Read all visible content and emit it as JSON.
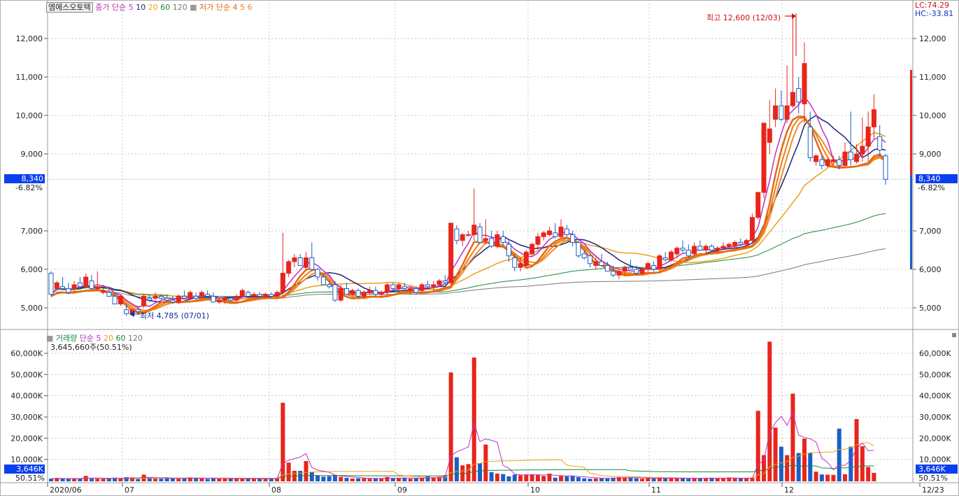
{
  "stock_name": "엠에스오토텍",
  "legend_price": {
    "ma_title": "종가 단순",
    "ma_periods": [
      "5",
      "10",
      "20",
      "60",
      "120"
    ],
    "env_title": "저가 단순",
    "env_periods": [
      "4",
      "5",
      "6"
    ]
  },
  "legend_volume": {
    "title": "거래량",
    "ma_title": "단순",
    "ma_periods": [
      "5",
      "20",
      "60",
      "120"
    ],
    "current": "3,645,660주(50.51%)"
  },
  "stats": {
    "lc": "LC:74.29",
    "hc": "HC:-33.81"
  },
  "annotations": {
    "high": "최고 12,600 (12/03)",
    "low": "최저 4,785 (07/01)"
  },
  "price_tag": {
    "value": "8,340",
    "change": "-6.82%"
  },
  "volume_tag": {
    "value": "3,646K",
    "pct": "50.51%"
  },
  "price_axis_labels": [
    "12,000",
    "11,000",
    "10,000",
    "9,000",
    "7,000",
    "6,000",
    "5,000"
  ],
  "volume_axis_labels": [
    "60,000K",
    "50,000K",
    "40,000K",
    "30,000K",
    "20,000K",
    "10,000K"
  ],
  "date_labels": [
    "2020/06",
    "07",
    "08",
    "09",
    "10",
    "11",
    "12",
    "12/23"
  ],
  "colors": {
    "up": "#e8251c",
    "down": "#1a5fc8",
    "ma5": "#c030c0",
    "ma10": "#1a237e",
    "ma20": "#e8a317",
    "ma60": "#1a8a3a",
    "ma120": "#7a7a7a",
    "env4": "#e36a12",
    "env5": "#ef7a1a",
    "env6": "#f08c2a"
  },
  "chart_data": {
    "type": "candlestick",
    "price_range": [
      4500,
      12900
    ],
    "volume_range_k": [
      0,
      68000
    ],
    "months": [
      "2020/06",
      "07",
      "08",
      "09",
      "10",
      "11",
      "12",
      "12/23"
    ],
    "ohlc_estimated": [
      [
        5900,
        5950,
        5300,
        5350
      ],
      [
        5500,
        5700,
        5450,
        5650
      ],
      [
        5550,
        5800,
        5450,
        5500
      ],
      [
        5500,
        5650,
        5350,
        5400
      ],
      [
        5500,
        5700,
        5400,
        5600
      ],
      [
        5650,
        5800,
        5500,
        5550
      ],
      [
        5550,
        5900,
        5500,
        5800
      ],
      [
        5700,
        5850,
        5450,
        5500
      ],
      [
        5500,
        5950,
        5450,
        5550
      ],
      [
        5400,
        5600,
        5350,
        5450
      ],
      [
        5400,
        5550,
        5300,
        5300
      ],
      [
        5300,
        5400,
        5100,
        5100
      ],
      [
        5100,
        5350,
        5050,
        5300
      ],
      [
        4950,
        5100,
        4785,
        4850
      ],
      [
        4850,
        5000,
        4800,
        4950
      ],
      [
        4950,
        5050,
        4850,
        4900
      ],
      [
        5050,
        5350,
        5000,
        5300
      ],
      [
        5250,
        5350,
        5150,
        5200
      ],
      [
        5250,
        5400,
        5200,
        5300
      ],
      [
        5300,
        5350,
        5200,
        5250
      ],
      [
        5250,
        5350,
        5150,
        5200
      ],
      [
        5200,
        5300,
        5100,
        5150
      ],
      [
        5150,
        5350,
        5100,
        5300
      ],
      [
        5300,
        5450,
        5250,
        5250
      ],
      [
        5250,
        5450,
        5200,
        5400
      ],
      [
        5300,
        5400,
        5200,
        5250
      ],
      [
        5300,
        5450,
        5250,
        5400
      ],
      [
        5350,
        5450,
        5250,
        5300
      ],
      [
        5300,
        5400,
        5150,
        5150
      ],
      [
        5150,
        5250,
        5100,
        5200
      ],
      [
        5200,
        5300,
        5100,
        5250
      ],
      [
        5250,
        5300,
        5150,
        5200
      ],
      [
        5200,
        5350,
        5150,
        5300
      ],
      [
        5300,
        5500,
        5250,
        5450
      ],
      [
        5400,
        5450,
        5300,
        5300
      ],
      [
        5300,
        5400,
        5250,
        5350
      ],
      [
        5350,
        5400,
        5250,
        5300
      ],
      [
        5300,
        5400,
        5250,
        5350
      ],
      [
        5350,
        5400,
        5250,
        5300
      ],
      [
        5300,
        5450,
        5250,
        5400
      ],
      [
        5400,
        6950,
        5350,
        5900
      ],
      [
        5900,
        6250,
        5800,
        6200
      ],
      [
        6200,
        6400,
        6050,
        6300
      ],
      [
        6300,
        6400,
        6100,
        6100
      ],
      [
        6050,
        6450,
        6000,
        6300
      ],
      [
        6300,
        6700,
        5950,
        6000
      ],
      [
        6000,
        6050,
        5700,
        5800
      ],
      [
        5800,
        5900,
        5600,
        5600
      ],
      [
        5600,
        5700,
        5500,
        5550
      ],
      [
        5600,
        5700,
        5150,
        5200
      ],
      [
        5200,
        5600,
        5150,
        5500
      ],
      [
        5500,
        5650,
        5350,
        5350
      ],
      [
        5350,
        5500,
        5300,
        5450
      ],
      [
        5450,
        5500,
        5250,
        5300
      ],
      [
        5300,
        5450,
        5250,
        5400
      ],
      [
        5400,
        5550,
        5350,
        5450
      ],
      [
        5450,
        5550,
        5300,
        5350
      ],
      [
        5350,
        5450,
        5250,
        5400
      ],
      [
        5400,
        5650,
        5350,
        5600
      ],
      [
        5600,
        5650,
        5450,
        5500
      ],
      [
        5500,
        5650,
        5450,
        5600
      ],
      [
        5550,
        5650,
        5450,
        5500
      ],
      [
        5450,
        5550,
        5350,
        5500
      ],
      [
        5500,
        5550,
        5350,
        5400
      ],
      [
        5450,
        5650,
        5400,
        5600
      ],
      [
        5600,
        5700,
        5500,
        5550
      ],
      [
        5550,
        5700,
        5450,
        5600
      ],
      [
        5600,
        5750,
        5550,
        5700
      ],
      [
        5700,
        5850,
        5600,
        5650
      ],
      [
        5650,
        7200,
        5600,
        7200
      ],
      [
        7050,
        7150,
        6650,
        6750
      ],
      [
        6750,
        6950,
        6600,
        6900
      ],
      [
        6900,
        7000,
        6850,
        6900
      ],
      [
        6900,
        8100,
        6750,
        7150
      ],
      [
        7100,
        7200,
        6650,
        6700
      ],
      [
        6750,
        7300,
        6650,
        6800
      ],
      [
        6800,
        7000,
        6550,
        6600
      ],
      [
        6600,
        7000,
        6550,
        6900
      ],
      [
        6850,
        7000,
        6600,
        6700
      ],
      [
        6650,
        6750,
        6200,
        6350
      ],
      [
        6300,
        6400,
        5950,
        6050
      ],
      [
        6050,
        6300,
        5950,
        6150
      ],
      [
        6100,
        6500,
        6050,
        6450
      ],
      [
        6400,
        6700,
        6350,
        6650
      ],
      [
        6650,
        6950,
        6500,
        6850
      ],
      [
        6850,
        7000,
        6750,
        6950
      ],
      [
        6900,
        7100,
        6850,
        7000
      ],
      [
        6950,
        7200,
        6800,
        6850
      ],
      [
        6850,
        7300,
        6800,
        7100
      ],
      [
        7050,
        7150,
        6850,
        6900
      ],
      [
        6900,
        7000,
        6600,
        6700
      ],
      [
        6700,
        6750,
        6300,
        6350
      ],
      [
        6400,
        6500,
        6250,
        6300
      ],
      [
        6350,
        6400,
        6050,
        6150
      ],
      [
        6100,
        6300,
        6000,
        6200
      ],
      [
        6200,
        6400,
        6100,
        6100
      ],
      [
        6100,
        6200,
        5950,
        5950
      ],
      [
        5950,
        6100,
        5800,
        5850
      ],
      [
        5850,
        6000,
        5750,
        5950
      ],
      [
        5950,
        6100,
        5850,
        6050
      ],
      [
        6050,
        6250,
        6000,
        6000
      ],
      [
        6000,
        6100,
        5850,
        5900
      ],
      [
        5900,
        6050,
        5850,
        6000
      ],
      [
        6000,
        6200,
        5950,
        6150
      ],
      [
        6100,
        6200,
        5950,
        6000
      ],
      [
        6000,
        6400,
        5950,
        6350
      ],
      [
        6300,
        6450,
        6200,
        6250
      ],
      [
        6250,
        6500,
        6200,
        6450
      ],
      [
        6400,
        6600,
        6300,
        6550
      ],
      [
        6550,
        6750,
        6450,
        6500
      ],
      [
        6500,
        6650,
        6300,
        6350
      ],
      [
        6400,
        6700,
        6350,
        6600
      ],
      [
        6600,
        6750,
        6500,
        6500
      ],
      [
        6500,
        6650,
        6400,
        6600
      ],
      [
        6600,
        6650,
        6450,
        6500
      ],
      [
        6500,
        6600,
        6450,
        6550
      ],
      [
        6550,
        6700,
        6500,
        6600
      ],
      [
        6600,
        6700,
        6550,
        6650
      ],
      [
        6600,
        6750,
        6550,
        6700
      ],
      [
        6700,
        6800,
        6600,
        6650
      ],
      [
        6650,
        6800,
        6600,
        6750
      ],
      [
        6750,
        7450,
        6700,
        7350
      ],
      [
        7350,
        7950,
        7300,
        8000
      ],
      [
        8000,
        9800,
        7850,
        9800
      ],
      [
        9300,
        10400,
        9000,
        9650
      ],
      [
        9900,
        10700,
        9700,
        10250
      ],
      [
        10250,
        10650,
        9850,
        9900
      ],
      [
        9900,
        11300,
        9800,
        10250
      ],
      [
        10250,
        12600,
        10200,
        10600
      ],
      [
        10700,
        11000,
        10050,
        10350
      ],
      [
        10300,
        11900,
        9800,
        11350
      ],
      [
        9700,
        10100,
        8800,
        8900
      ],
      [
        8800,
        9000,
        8700,
        8950
      ],
      [
        8850,
        8950,
        8600,
        8700
      ],
      [
        8700,
        8900,
        8650,
        8850
      ],
      [
        8800,
        8950,
        8700,
        8850
      ],
      [
        8850,
        8950,
        8600,
        8700
      ],
      [
        8700,
        9300,
        8650,
        9050
      ],
      [
        9050,
        10100,
        8700,
        8850
      ],
      [
        8800,
        9250,
        8750,
        9000
      ],
      [
        9000,
        9950,
        8800,
        9200
      ],
      [
        9200,
        10100,
        8800,
        9700
      ],
      [
        9700,
        10550,
        9400,
        10150
      ],
      [
        9450,
        9750,
        8950,
        9100
      ],
      [
        8950,
        9000,
        8200,
        8340
      ]
    ],
    "volume_estimated_k": [
      900,
      1200,
      900,
      800,
      1000,
      1000,
      2200,
      900,
      800,
      800,
      900,
      1400,
      1000,
      1600,
      1500,
      700,
      2800,
      1200,
      900,
      900,
      1500,
      1000,
      900,
      1200,
      1500,
      1000,
      1100,
      800,
      1300,
      800,
      800,
      1000,
      900,
      900,
      1200,
      800,
      800,
      900,
      1000,
      1100,
      36700,
      8500,
      4600,
      4600,
      9200,
      4100,
      2300,
      1900,
      2100,
      2700,
      1700,
      1300,
      1000,
      1100,
      1200,
      900,
      1000,
      900,
      1700,
      1200,
      1000,
      1400,
      900,
      1300,
      1100,
      2000,
      1400,
      1800,
      2500,
      51000,
      11000,
      7200,
      7800,
      58000,
      8200,
      17000,
      4000,
      3300,
      3100,
      2000,
      2800,
      2500,
      2900,
      3000,
      2600,
      2200,
      3300,
      1400,
      2200,
      2000,
      2200,
      1600,
      1100,
      900,
      1000,
      1200,
      1100,
      1400,
      1600,
      1500,
      1400,
      1100,
      900,
      1200,
      1000,
      1400,
      1300,
      1100,
      1000,
      1200,
      900,
      1100,
      1000,
      1000,
      1400,
      1000,
      1100,
      1500,
      1200,
      1000,
      1000,
      1400,
      32900,
      12000,
      65500,
      25000,
      16000,
      12000,
      41000,
      13000,
      19800,
      13000,
      4200,
      2900,
      2800,
      2700,
      24500,
      3000,
      16000,
      29000,
      16200,
      6400,
      3646
    ]
  }
}
